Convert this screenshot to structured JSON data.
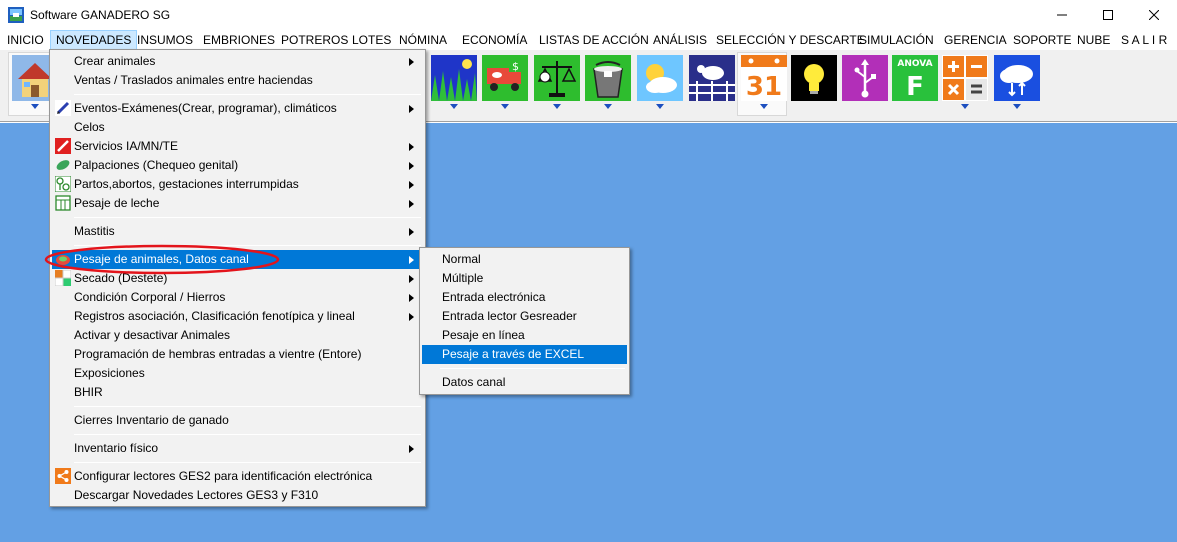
{
  "window": {
    "title": "Software GANADERO SG",
    "icon": "app-logo-icon"
  },
  "menubar": {
    "items": [
      {
        "label": "INICIO",
        "key": "inicio"
      },
      {
        "label": "NOVEDADES",
        "key": "novedades",
        "active": true
      },
      {
        "label": "INSUMOS",
        "key": "insumos"
      },
      {
        "label": "EMBRIONES",
        "key": "embriones"
      },
      {
        "label": "POTREROS",
        "key": "potreros"
      },
      {
        "label": "LOTES",
        "key": "lotes"
      },
      {
        "label": "NÓMINA",
        "key": "nomina"
      },
      {
        "label": "ECONOMÍA",
        "key": "economia"
      },
      {
        "label": "LISTAS DE ACCIÓN",
        "key": "listas"
      },
      {
        "label": "ANÁLISIS",
        "key": "analisis"
      },
      {
        "label": "SELECCIÓN Y DESCARTE",
        "key": "seleccion"
      },
      {
        "label": "SIMULACIÓN",
        "key": "simulacion"
      },
      {
        "label": "GERENCIA",
        "key": "gerencia"
      },
      {
        "label": "SOPORTE",
        "key": "soporte"
      },
      {
        "label": "NUBE",
        "key": "nube"
      },
      {
        "label": "S A L I R",
        "key": "salir"
      }
    ]
  },
  "toolbar": {
    "calendar_day": "31",
    "anova_label": "ANOVA",
    "anova_letter": "F",
    "icons": [
      "house-icon",
      "grass-field-icon",
      "truck-money-icon",
      "cow-scale-icon",
      "milk-bucket-icon",
      "weather-icon",
      "cow-pen-icon",
      "calendar-icon",
      "lightbulb-icon",
      "usb-icon",
      "anova-icon",
      "calculator-icon",
      "cloud-sync-icon"
    ]
  },
  "novedades_menu": {
    "items": {
      "crear": "Crear animales",
      "ventas": "Ventas / Traslados animales entre haciendas",
      "eventos": "Eventos-Exámenes(Crear, programar), climáticos",
      "celos": "Celos",
      "servicios": "Servicios IA/MN/TE",
      "palpaciones": "Palpaciones (Chequeo genital)",
      "partos": "Partos,abortos, gestaciones interrumpidas",
      "pesaje_leche": "Pesaje de leche",
      "mastitis": "Mastitis",
      "pesaje_animales": "Pesaje de animales, Datos canal",
      "secado": "Secado (Destete)",
      "condicion": "Condición Corporal / Hierros",
      "registros": "Registros asociación, Clasificación fenotípica y lineal",
      "activar": "Activar y desactivar Animales",
      "programacion": "Programación de hembras entradas a vientre (Entore)",
      "exposiciones": "Exposiciones",
      "bhir": "BHIR",
      "cierres": "Cierres Inventario de ganado",
      "inventario": "Inventario físico",
      "configurar": "Configurar lectores GES2 para identificación electrónica",
      "descargar": "Descargar Novedades Lectores GES3 y F310"
    }
  },
  "pesaje_submenu": {
    "items": {
      "normal": "Normal",
      "multiple": "Múltiple",
      "entrada_electronica": "Entrada electrónica",
      "entrada_lector": "Entrada lector Gesreader",
      "pesaje_linea": "Pesaje en línea",
      "pesaje_excel": "Pesaje a través de EXCEL",
      "datos_canal": "Datos canal"
    }
  }
}
